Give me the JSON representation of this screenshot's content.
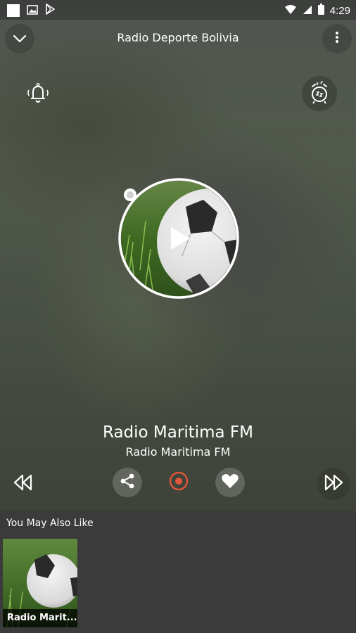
{
  "status_bar": {
    "time": "4:29"
  },
  "header": {
    "title": "Radio Deporte Bolivia"
  },
  "now_playing": {
    "station_name": "Radio Maritima FM",
    "station_subtitle": "Radio Maritima FM"
  },
  "recommendations": {
    "title": "You May Also Like",
    "items": [
      {
        "label": "Radio Marit..."
      }
    ]
  },
  "colors": {
    "record_accent": "#e0553b",
    "text": "#ffffff",
    "bottom_bg": "#3b3b3b"
  }
}
